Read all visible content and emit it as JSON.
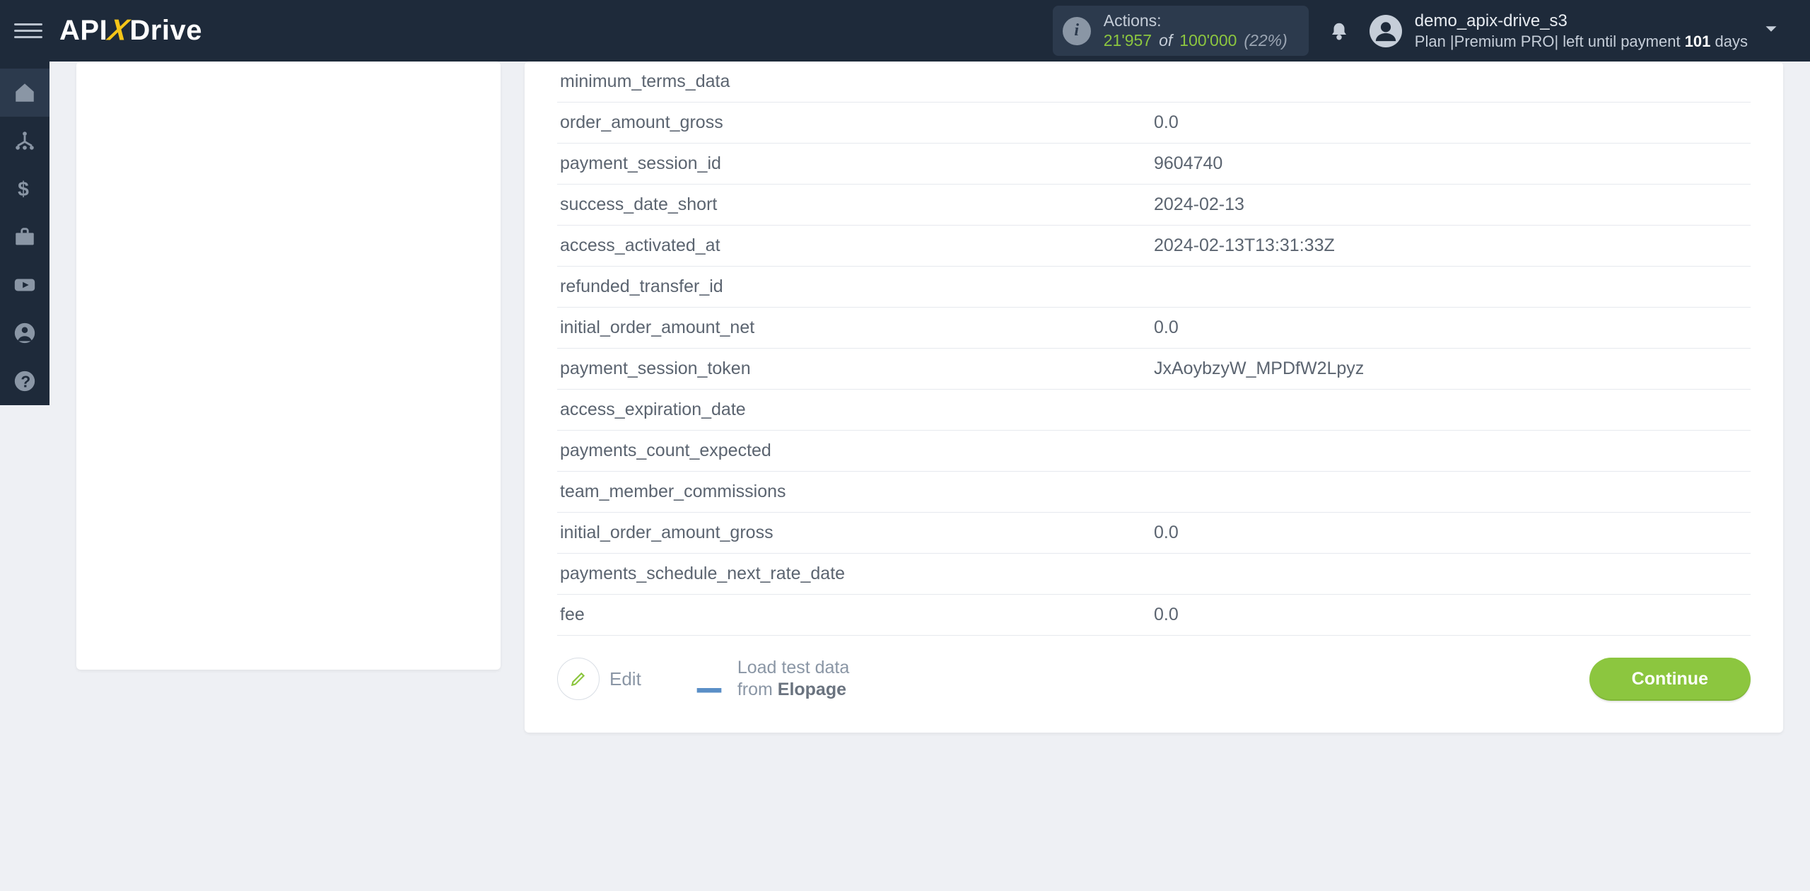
{
  "brand": {
    "api": "API",
    "x": "X",
    "drive": "Drive"
  },
  "actions": {
    "label": "Actions:",
    "used": "21'957",
    "of": "of",
    "limit": "100'000",
    "pct": "(22%)"
  },
  "user": {
    "name": "demo_apix-drive_s3",
    "plan_prefix": "Plan |",
    "plan_name": "Premium PRO",
    "plan_mid": "| left until payment ",
    "plan_days": "101",
    "plan_suffix": " days"
  },
  "table": [
    {
      "key": "minimum_terms_data",
      "val": ""
    },
    {
      "key": "order_amount_gross",
      "val": "0.0"
    },
    {
      "key": "payment_session_id",
      "val": "9604740"
    },
    {
      "key": "success_date_short",
      "val": "2024-02-13"
    },
    {
      "key": "access_activated_at",
      "val": "2024-02-13T13:31:33Z"
    },
    {
      "key": "refunded_transfer_id",
      "val": ""
    },
    {
      "key": "initial_order_amount_net",
      "val": "0.0"
    },
    {
      "key": "payment_session_token",
      "val": "JxAoybzyW_MPDfW2Lpyz"
    },
    {
      "key": "access_expiration_date",
      "val": ""
    },
    {
      "key": "payments_count_expected",
      "val": ""
    },
    {
      "key": "team_member_commissions",
      "val": ""
    },
    {
      "key": "initial_order_amount_gross",
      "val": "0.0"
    },
    {
      "key": "payments_schedule_next_rate_date",
      "val": ""
    },
    {
      "key": "fee",
      "val": "0.0"
    }
  ],
  "buttons": {
    "edit": "Edit",
    "load_line1": "Load test data",
    "load_from": "from ",
    "load_source": "Elopage",
    "continue": "Continue"
  }
}
